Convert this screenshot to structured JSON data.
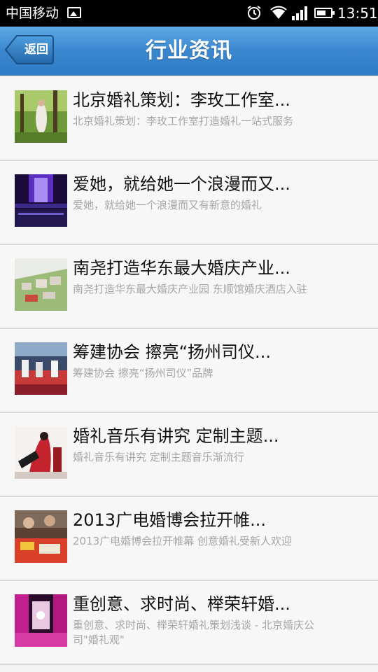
{
  "status_bar": {
    "carrier": "中国移动",
    "time": "13:51",
    "icons": [
      "image-icon",
      "alarm-icon",
      "wifi-icon",
      "signal-icon",
      "battery-icon"
    ]
  },
  "header": {
    "back_label": "返回",
    "title": "行业资讯",
    "accent_color": "#3a87cf"
  },
  "news": [
    {
      "title": "北京婚礼策划：李玫工作室...",
      "desc": "北京婚礼策划：李玫工作室打造婚礼一站式服务",
      "thumb": "forest-wedding-photo"
    },
    {
      "title": "爱她，就给她一个浪漫而又...",
      "desc": "爱她，就给她一个浪漫而又有新意的婚礼",
      "thumb": "purple-stage-photo"
    },
    {
      "title": "南尧打造华东最大婚庆产业...",
      "desc": "南尧打造华东最大婚庆产业园 东顺馆婚庆酒店入驻",
      "thumb": "industrial-park-rendering"
    },
    {
      "title": "筹建协会 擦亮“扬州司仪...",
      "desc": "筹建协会 擦亮“扬州司仪”品牌",
      "thumb": "banquet-hall-photo"
    },
    {
      "title": "婚礼音乐有讲究 定制主题...",
      "desc": "婚礼音乐有讲究 定制主题音乐渐流行",
      "thumb": "music-poster-photo"
    },
    {
      "title": "2013广电婚博会拉开帷...",
      "desc": "2013广电婚博会拉开帷幕 创意婚礼受新人欢迎",
      "thumb": "expo-photo"
    },
    {
      "title": "重创意、求时尚、榉荣轩婚...",
      "desc": "重创意、求时尚、榉荣轩婚礼策划浅谈 - 北京婚庆公司\"婚礼观\"",
      "thumb": "magenta-stage-photo"
    }
  ]
}
